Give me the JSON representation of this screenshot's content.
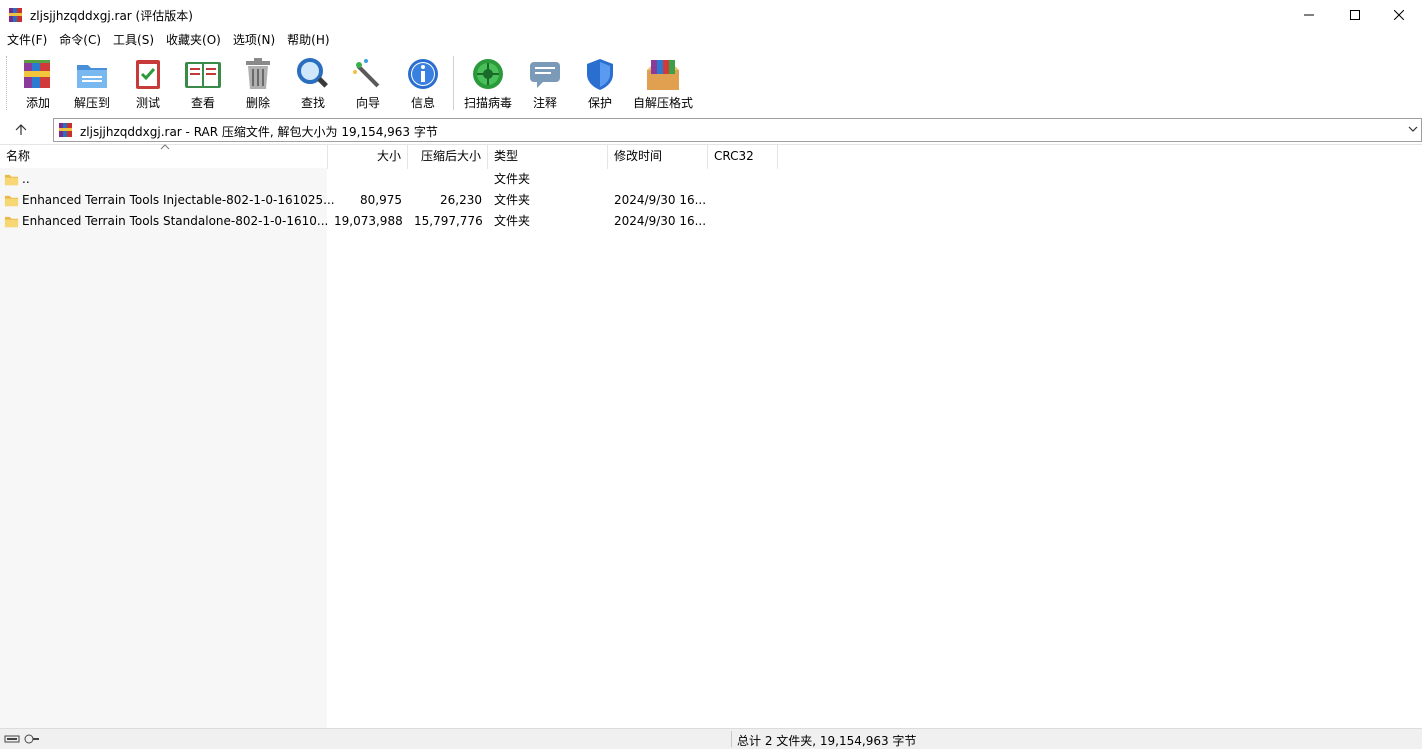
{
  "window": {
    "title": "zljsjjhzqddxgj.rar (评估版本)",
    "icon": "winrar-icon"
  },
  "menu": [
    "文件(F)",
    "命令(C)",
    "工具(S)",
    "收藏夹(O)",
    "选项(N)",
    "帮助(H)"
  ],
  "toolbar": [
    {
      "label": "添加",
      "icon": "add-archive-icon"
    },
    {
      "label": "解压到",
      "icon": "extract-folder-icon"
    },
    {
      "label": "测试",
      "icon": "test-clipboard-icon"
    },
    {
      "label": "查看",
      "icon": "view-book-icon"
    },
    {
      "label": "删除",
      "icon": "trash-icon"
    },
    {
      "label": "查找",
      "icon": "magnifier-icon"
    },
    {
      "label": "向导",
      "icon": "wizard-wand-icon"
    },
    {
      "label": "信息",
      "icon": "info-icon"
    },
    {
      "label": "扫描病毒",
      "icon": "virus-scan-icon"
    },
    {
      "label": "注释",
      "icon": "comment-icon"
    },
    {
      "label": "保护",
      "icon": "shield-icon"
    },
    {
      "label": "自解压格式",
      "icon": "sfx-box-icon"
    }
  ],
  "address": {
    "text": "zljsjjhzqddxgj.rar - RAR 压缩文件, 解包大小为 19,154,963 字节"
  },
  "columns": {
    "name": "名称",
    "size": "大小",
    "packed": "压缩后大小",
    "type": "类型",
    "modified": "修改时间",
    "crc": "CRC32"
  },
  "rows": [
    {
      "name": "..",
      "size": "",
      "packed": "",
      "type": "文件夹",
      "modified": "",
      "crc": ""
    },
    {
      "name": "Enhanced Terrain Tools Injectable-802-1-0-161025...",
      "size": "80,975",
      "packed": "26,230",
      "type": "文件夹",
      "modified": "2024/9/30 16...",
      "crc": ""
    },
    {
      "name": "Enhanced Terrain Tools Standalone-802-1-0-1610...",
      "size": "19,073,988",
      "packed": "15,797,776",
      "type": "文件夹",
      "modified": "2024/9/30 16...",
      "crc": ""
    }
  ],
  "status": {
    "text": "总计 2 文件夹, 19,154,963 字节"
  },
  "colors": {
    "folder": "#f7d774",
    "pane": "#f7f7f7",
    "statusbar": "#f0f0f0"
  }
}
